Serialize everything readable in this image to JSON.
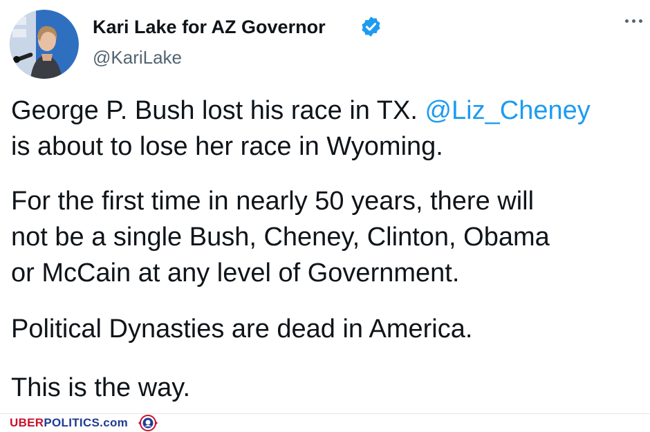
{
  "author": {
    "display_name": "Kari Lake for AZ Governor",
    "handle": "@KariLake",
    "verified_icon": "verified-badge-icon",
    "avatar_icon": "profile-photo"
  },
  "menu": {
    "icon": "more-options-icon"
  },
  "tweet": {
    "line1_text": "George P. Bush lost his race in TX. ",
    "line1_mention": "@Liz_Cheney",
    "line2_text": "is about to lose her race in Wyoming.",
    "para2": [
      "For the first time in nearly 50 years, there will",
      "not be a single Bush, Cheney, Clinton, Obama",
      "or McCain at any level of Government."
    ],
    "para3": "Political Dynasties are dead in America.",
    "para4": "This is the way."
  },
  "footer": {
    "brand_part1": "UBER",
    "brand_part2": "POLITICS.com",
    "logo_icon": "uberpolitics-seal-icon"
  },
  "colors": {
    "link": "#1d9bf0",
    "text": "#0f1419",
    "secondary": "#536471",
    "brand_red": "#c8102e",
    "brand_blue": "#1f3a93"
  }
}
